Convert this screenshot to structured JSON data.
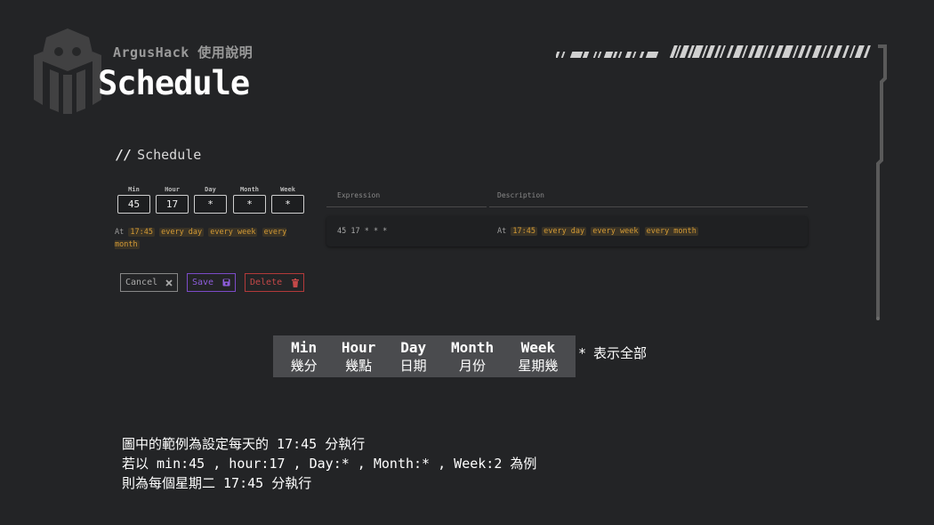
{
  "header": {
    "subtitle": "ArgusHack 使用說明",
    "title": "Schedule"
  },
  "panel": {
    "heading_bars": "//",
    "heading": "Schedule",
    "fields": [
      {
        "label": "Min",
        "value": "45"
      },
      {
        "label": "Hour",
        "value": "17"
      },
      {
        "label": "Day",
        "value": "*"
      },
      {
        "label": "Month",
        "value": "*"
      },
      {
        "label": "Week",
        "value": "*"
      }
    ],
    "description_prefix": "At",
    "description_time": "17:45",
    "description_tags": [
      "every day",
      "every week",
      "every month"
    ],
    "buttons": {
      "cancel": "Cancel",
      "save": "Save",
      "delete": "Delete"
    },
    "table": {
      "headers": [
        "Expression",
        "Description"
      ],
      "row": {
        "expression": "45 17 * * *",
        "desc_prefix": "At",
        "desc_time": "17:45",
        "desc_tags": [
          "every day",
          "every week",
          "every month"
        ]
      }
    }
  },
  "legend": {
    "items": [
      {
        "en": "Min",
        "zh": "幾分"
      },
      {
        "en": "Hour",
        "zh": "幾點"
      },
      {
        "en": "Day",
        "zh": "日期"
      },
      {
        "en": "Month",
        "zh": "月份"
      },
      {
        "en": "Week",
        "zh": "星期幾"
      }
    ],
    "star": "*",
    "star_text": "表示全部"
  },
  "notes": [
    "圖中的範例為設定每天的 17:45 分執行",
    "若以 min:45 , hour:17 , Day:* , Month:* , Week:2 為例",
    "則為每個星期二 17:45 分執行"
  ],
  "colors": {
    "background": "#232426",
    "highlight": "#d39a35",
    "save": "#7c4bc8",
    "delete": "#b33a3a"
  }
}
